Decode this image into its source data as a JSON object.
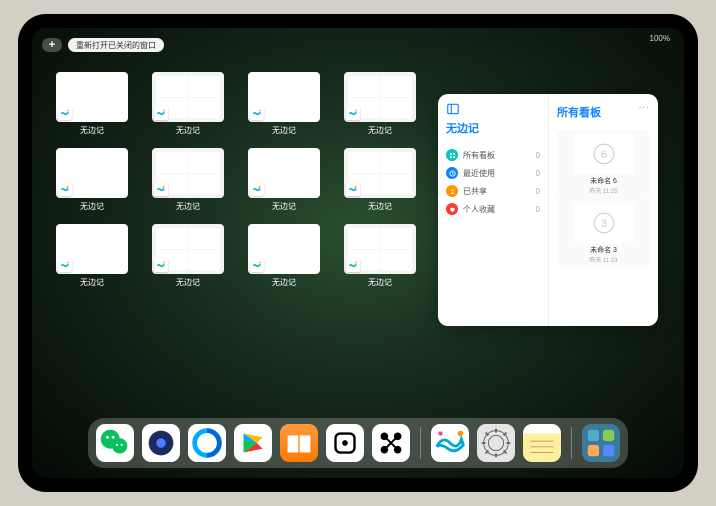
{
  "status_text": "100%",
  "topbar": {
    "plus": "+",
    "reopen": "重新打开已关闭的窗口"
  },
  "app_label": "无边记",
  "windows": [
    {
      "style": "blank"
    },
    {
      "style": "grid"
    },
    {
      "style": "blank"
    },
    {
      "style": "grid"
    },
    {
      "style": "blank"
    },
    {
      "style": "grid"
    },
    {
      "style": "blank"
    },
    {
      "style": "grid"
    },
    {
      "style": "blank"
    },
    {
      "style": "grid"
    },
    {
      "style": "blank"
    },
    {
      "style": "grid"
    }
  ],
  "panel": {
    "title": "无边记",
    "more": "...",
    "categories": [
      {
        "icon": "grid",
        "color": "#00c7be",
        "label": "所有看板",
        "count": "0"
      },
      {
        "icon": "clock",
        "color": "#0a84ff",
        "label": "最近使用",
        "count": "0"
      },
      {
        "icon": "share",
        "color": "#ff9500",
        "label": "已共享",
        "count": "0"
      },
      {
        "icon": "heart",
        "color": "#ff3b30",
        "label": "个人收藏",
        "count": "0"
      }
    ],
    "right_title": "所有看板",
    "boards": [
      {
        "sketch": "6",
        "name": "未命名 6",
        "time": "昨天 11:25"
      },
      {
        "sketch": "3",
        "name": "未命名 3",
        "time": "昨天 11:23"
      }
    ]
  },
  "dock": [
    {
      "name": "wechat",
      "bg": "#fff"
    },
    {
      "name": "quark",
      "bg": "#fff"
    },
    {
      "name": "qqbrowser",
      "bg": "#fff"
    },
    {
      "name": "play",
      "bg": "#fff"
    },
    {
      "name": "books",
      "bg": "linear-gradient(#ff9a3c,#ff7a00)"
    },
    {
      "name": "dice",
      "bg": "#fff"
    },
    {
      "name": "connect",
      "bg": "#fff"
    },
    {
      "name": "freeform",
      "bg": "#fff"
    },
    {
      "name": "settings",
      "bg": "#e5e5e5"
    },
    {
      "name": "notes",
      "bg": "linear-gradient(#fff 0%,#fff 25%,#fdeea0 25%,#fdeea0 100%)"
    },
    {
      "name": "launcher",
      "bg": "#3a7a9a"
    }
  ]
}
